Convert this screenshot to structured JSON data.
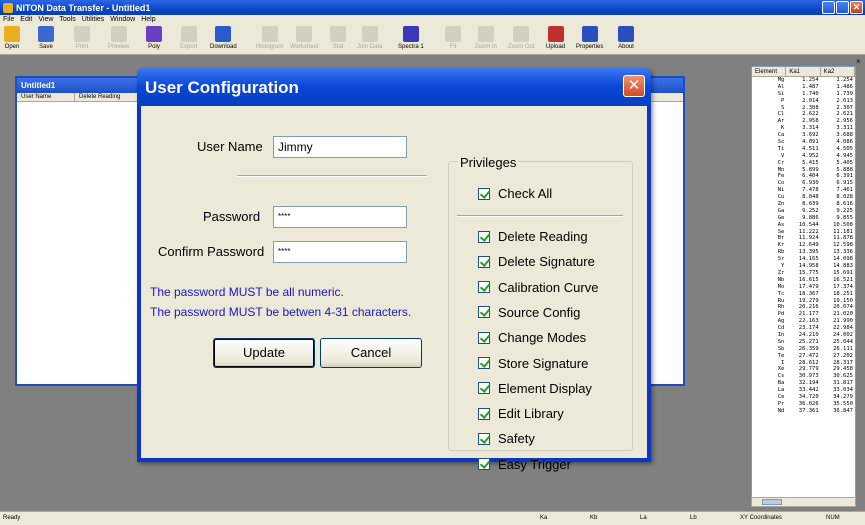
{
  "app": {
    "title": "NITON Data Transfer - Untitled1"
  },
  "menu": [
    "File",
    "Edit",
    "View",
    "Tools",
    "Utilities",
    "Window",
    "Help"
  ],
  "toolbar": [
    {
      "label": "Open",
      "icon": "open-folder-icon",
      "enabled": true
    },
    {
      "label": "Save",
      "icon": "save-disk-icon",
      "enabled": true
    },
    {
      "label": "Print",
      "icon": "printer-icon",
      "enabled": false
    },
    {
      "label": "Preview",
      "icon": "print-preview-icon",
      "enabled": false
    },
    {
      "label": "Poly",
      "icon": "poly-icon",
      "enabled": true
    },
    {
      "label": "Export",
      "icon": "export-icon",
      "enabled": false
    },
    {
      "label": "Download",
      "icon": "download-icon",
      "enabled": true
    },
    {
      "label": "Histogram",
      "icon": "histogram-icon",
      "enabled": false
    },
    {
      "label": "Worksheet",
      "icon": "worksheet-icon",
      "enabled": false
    },
    {
      "label": "Stat",
      "icon": "stat-icon",
      "enabled": false
    },
    {
      "label": "Join Data",
      "icon": "join-data-icon",
      "enabled": false
    },
    {
      "label": "Spectra 1",
      "icon": "spectra-icon",
      "enabled": true
    },
    {
      "label": "Fit",
      "icon": "fit-icon",
      "enabled": false
    },
    {
      "label": "Zoom In",
      "icon": "zoom-in-icon",
      "enabled": false
    },
    {
      "label": "Zoom Out",
      "icon": "zoom-out-icon",
      "enabled": false
    },
    {
      "label": "Upload",
      "icon": "upload-icon",
      "enabled": true
    },
    {
      "label": "Properties",
      "icon": "properties-icon",
      "enabled": true
    },
    {
      "label": "About",
      "icon": "about-icon",
      "enabled": true
    }
  ],
  "child_window": {
    "title": "Untitled1",
    "columns": [
      "User Name",
      "Delete Reading"
    ]
  },
  "dialog": {
    "title": "User Configuration",
    "user_name_label": "User Name",
    "user_name_value": "Jimmy",
    "password_label": "Password",
    "password_value": "****",
    "confirm_label": "Confirm Password",
    "confirm_value": "****",
    "note1": "The password MUST be all numeric.",
    "note2": "The password MUST be betwen 4-31 characters.",
    "update_label": "Update",
    "cancel_label": "Cancel",
    "privileges_label": "Privileges",
    "check_all_label": "Check All",
    "privileges": [
      {
        "label": "Delete Reading",
        "checked": true
      },
      {
        "label": "Delete Signature",
        "checked": true
      },
      {
        "label": "Calibration Curve",
        "checked": true
      },
      {
        "label": "Source Config",
        "checked": true
      },
      {
        "label": "Change Modes",
        "checked": true
      },
      {
        "label": "Store Signature",
        "checked": true
      },
      {
        "label": "Element Display",
        "checked": true
      },
      {
        "label": "Edit Library",
        "checked": true
      },
      {
        "label": "Safety",
        "checked": true
      },
      {
        "label": "Easy Trigger",
        "checked": true
      }
    ]
  },
  "element_panel": {
    "columns": [
      "Element",
      "Ka1",
      "Ka2"
    ],
    "rows": [
      [
        "Mg",
        "1.254",
        "1.254"
      ],
      [
        "Al",
        "1.487",
        "1.486"
      ],
      [
        "Si",
        "1.740",
        "1.739"
      ],
      [
        "P",
        "2.014",
        "2.013"
      ],
      [
        "S",
        "2.308",
        "2.307"
      ],
      [
        "Cl",
        "2.622",
        "2.621"
      ],
      [
        "Ar",
        "2.958",
        "2.956"
      ],
      [
        "K",
        "3.314",
        "3.311"
      ],
      [
        "Ca",
        "3.692",
        "3.688"
      ],
      [
        "Sc",
        "4.091",
        "4.086"
      ],
      [
        "Ti",
        "4.511",
        "4.505"
      ],
      [
        "V",
        "4.952",
        "4.945"
      ],
      [
        "Cr",
        "5.415",
        "5.405"
      ],
      [
        "Mn",
        "5.899",
        "5.888"
      ],
      [
        "Fe",
        "6.404",
        "6.391"
      ],
      [
        "Co",
        "6.930",
        "6.915"
      ],
      [
        "Ni",
        "7.478",
        "7.461"
      ],
      [
        "Cu",
        "8.048",
        "8.028"
      ],
      [
        "Zn",
        "8.639",
        "8.616"
      ],
      [
        "Ga",
        "9.252",
        "9.225"
      ],
      [
        "Ge",
        "9.886",
        "9.855"
      ],
      [
        "As",
        "10.544",
        "10.508"
      ],
      [
        "Se",
        "11.222",
        "11.181"
      ],
      [
        "Br",
        "11.924",
        "11.878"
      ],
      [
        "Kr",
        "12.649",
        "12.598"
      ],
      [
        "Rb",
        "13.395",
        "13.336"
      ],
      [
        "Sr",
        "14.165",
        "14.098"
      ],
      [
        "Y",
        "14.958",
        "14.883"
      ],
      [
        "Zr",
        "15.775",
        "15.691"
      ],
      [
        "Nb",
        "16.615",
        "16.521"
      ],
      [
        "Mo",
        "17.479",
        "17.374"
      ],
      [
        "Tc",
        "18.367",
        "18.251"
      ],
      [
        "Ru",
        "19.279",
        "19.150"
      ],
      [
        "Rh",
        "20.216",
        "20.074"
      ],
      [
        "Pd",
        "21.177",
        "21.020"
      ],
      [
        "Ag",
        "22.163",
        "21.990"
      ],
      [
        "Cd",
        "23.174",
        "22.984"
      ],
      [
        "In",
        "24.210",
        "24.002"
      ],
      [
        "Sn",
        "25.271",
        "25.044"
      ],
      [
        "Sb",
        "26.359",
        "26.111"
      ],
      [
        "Te",
        "27.472",
        "27.202"
      ],
      [
        "I",
        "28.612",
        "28.317"
      ],
      [
        "Xe",
        "29.779",
        "29.458"
      ],
      [
        "Cs",
        "30.973",
        "30.625"
      ],
      [
        "Ba",
        "32.194",
        "31.817"
      ],
      [
        "La",
        "33.442",
        "33.034"
      ],
      [
        "Ce",
        "34.720",
        "34.279"
      ],
      [
        "Pr",
        "36.026",
        "35.550"
      ],
      [
        "Nd",
        "37.361",
        "36.847"
      ]
    ]
  },
  "statusbar": {
    "ready": "Ready",
    "ka": "Ka",
    "kb": "Kb",
    "la": "La",
    "lb": "Lb",
    "coords": "XY Coordinates",
    "num": "NUM"
  }
}
